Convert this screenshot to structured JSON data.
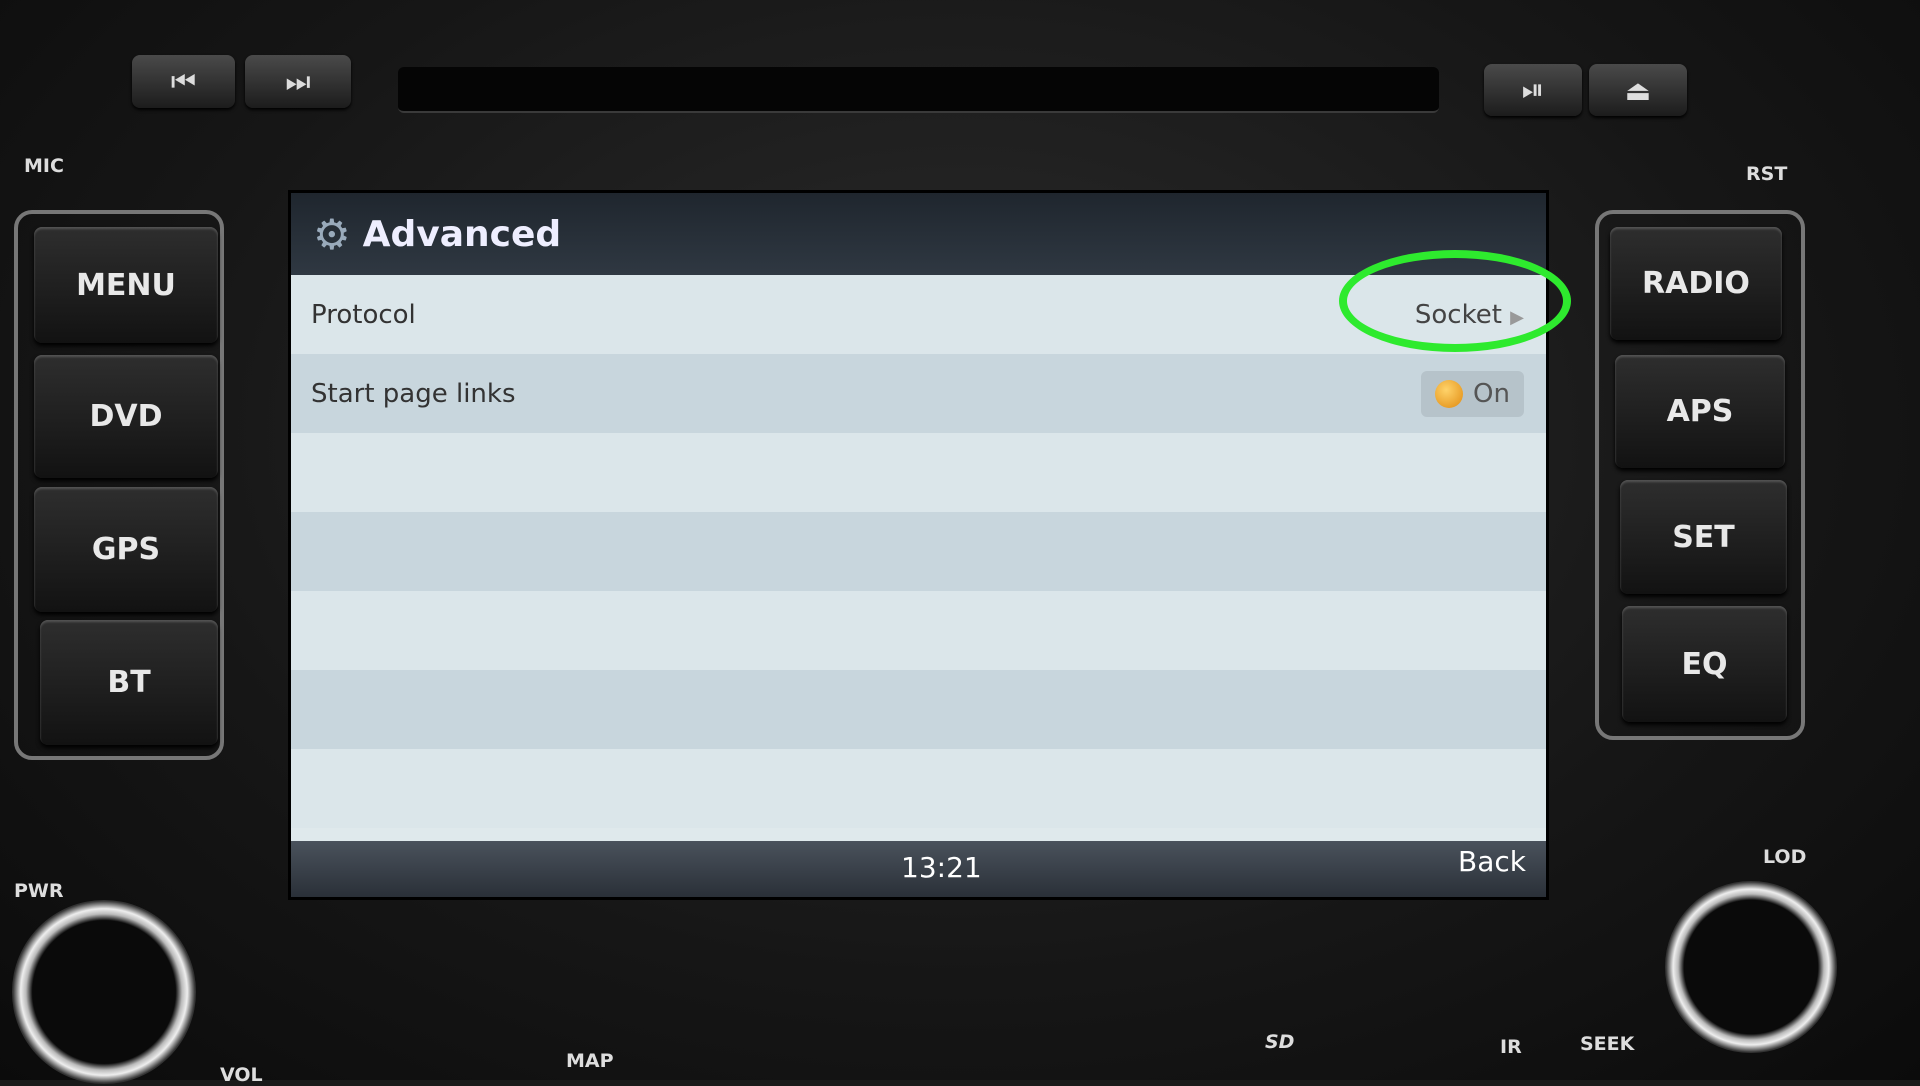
{
  "hardware": {
    "top_buttons": [
      {
        "name": "previous-track",
        "glyph": "⏮"
      },
      {
        "name": "next-track",
        "glyph": "⏭"
      },
      {
        "name": "play-pause",
        "glyph": "⏯"
      },
      {
        "name": "eject",
        "glyph": "⏏"
      }
    ],
    "left_buttons": [
      "MENU",
      "DVD",
      "GPS",
      "BT"
    ],
    "right_buttons": [
      "RADIO",
      "APS",
      "SET",
      "EQ"
    ],
    "labels": {
      "mic": "MIC",
      "rst": "RST",
      "pwr": "PWR",
      "lod": "LOD",
      "map": "MAP",
      "sd": "SD",
      "ir": "IR",
      "seek": "SEEK",
      "vol": "VOL"
    }
  },
  "screen": {
    "title": "Advanced",
    "title_icon": "gear-icon",
    "settings": [
      {
        "label": "Protocol",
        "value": "Socket",
        "type": "submenu"
      },
      {
        "label": "Start page links",
        "value": "On",
        "type": "toggle",
        "state": true
      }
    ],
    "footer": {
      "time": "13:21",
      "back_label": "Back"
    }
  },
  "annotation": {
    "color": "#2eea2e",
    "shape": "ellipse",
    "target": "Protocol value"
  }
}
